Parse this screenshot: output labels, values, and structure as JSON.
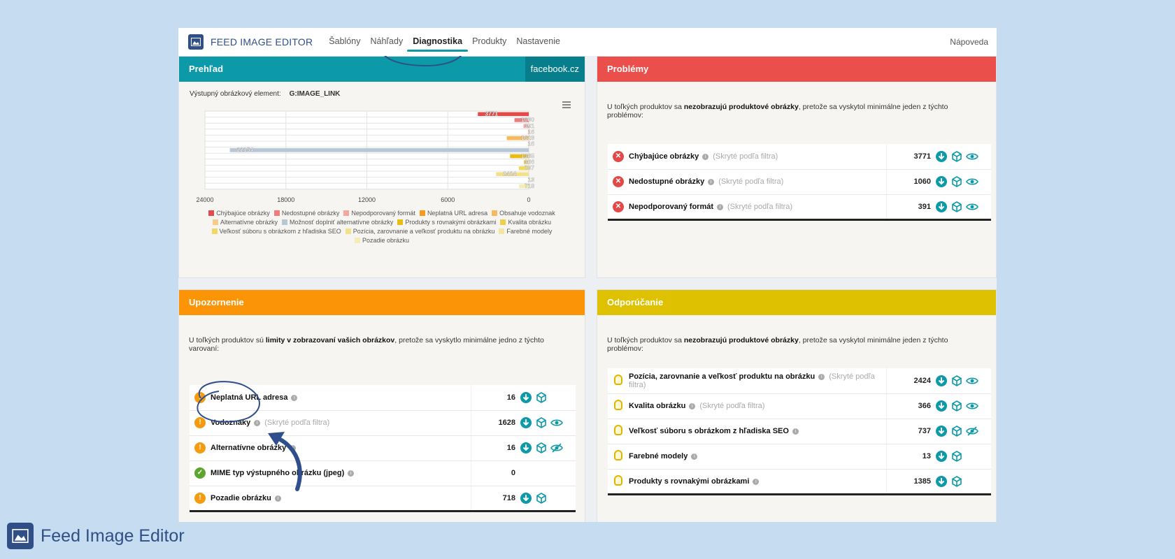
{
  "nav": {
    "brand": "FEED IMAGE EDITOR",
    "items": [
      "Šablóny",
      "Náhľady",
      "Diagnostika",
      "Produkty",
      "Nastavenie"
    ],
    "active": "Diagnostika",
    "help": "Nápoveda"
  },
  "overview": {
    "title": "Prehľad",
    "domain": "facebook.cz",
    "output_label": "Výstupný obrázkový element:",
    "output_value": "G:IMAGE_LINK"
  },
  "chart_data": {
    "type": "bar",
    "orientation": "horizontal",
    "xlim": [
      24000,
      0
    ],
    "xticks": [
      "24000",
      "18000",
      "12000",
      "6000",
      "0"
    ],
    "categories": [
      "Chýbajúce obrázky",
      "Nedostupné obrázky",
      "Nepodporovaný formát",
      "Neplatná URL adresa",
      "Obsahuje vodoznak",
      "Alternatívne obrázky",
      "Možnosť doplniť alternatívne obrázky",
      "Produkty s rovnakými obrázkami",
      "Kvalita obrázku",
      "Veľkosť súboru s obrázkom z hľadiska SEO",
      "Pozícia, zarovnanie a veľkosť produktu na obrázku",
      "Farebné modely",
      "Pozadie obrázku"
    ],
    "values": [
      3771,
      1060,
      391,
      16,
      1628,
      16,
      22154,
      1385,
      366,
      737,
      2424,
      13,
      718
    ],
    "colors": [
      "#e34b4b",
      "#ef7b7b",
      "#f5a6a0",
      "#f79a1c",
      "#f9b95a",
      "#f7cb8c",
      "#b8c7d6",
      "#e9bd14",
      "#efce4a",
      "#f0d864",
      "#f2e08a",
      "#f3e6a0",
      "#f5ecb6"
    ],
    "legend": [
      "Chýbajúce obrázky",
      "Nedostupné obrázky",
      "Nepodporovaný formát",
      "Neplatná URL adresa",
      "Obsahuje vodoznak",
      "Alternatívne obrázky",
      "Možnosť doplniť alternatívne obrázky",
      "Produkty s rovnakými obrázkami",
      "Kvalita obrázku",
      "Veľkosť súboru s obrázkom z hľadiska SEO",
      "Pozícia, zarovnanie a veľkosť produktu na obrázku",
      "Farebné modely",
      "Pozadie obrázku"
    ]
  },
  "problems": {
    "title": "Problémy",
    "desc_pre": "U toľkých produktov sa ",
    "desc_bold": "nezobrazujú produktové obrázky",
    "desc_post": ", pretože sa vyskytol minimálne jeden z týchto problémov:",
    "rows": [
      {
        "name": "Chýbajúce obrázky",
        "hidden": "(Skryté podľa filtra)",
        "count": "3771"
      },
      {
        "name": "Nedostupné obrázky",
        "hidden": "(Skryté podľa filtra)",
        "count": "1060"
      },
      {
        "name": "Nepodporovaný formát",
        "hidden": "(Skryté podľa filtra)",
        "count": "391"
      }
    ]
  },
  "warnings": {
    "title": "Upozornenie",
    "desc_pre": "U toľkých produktov sú ",
    "desc_bold": "limity v zobrazovaní vašich obrázkov",
    "desc_post": ", pretože sa vyskytlo minimálne jedno z týchto varovaní:",
    "rows": [
      {
        "name": "Neplatná URL adresa",
        "hidden": "",
        "count": "16"
      },
      {
        "name": "Vodoznaky",
        "hidden": "(Skryté podľa filtra)",
        "count": "1628"
      },
      {
        "name": "Alternatívne obrázky",
        "hidden": "",
        "count": "16"
      },
      {
        "name": "MIME typ výstupného obrázku (jpeg)",
        "hidden": "",
        "count": "0"
      },
      {
        "name": "Pozadie obrázku",
        "hidden": "",
        "count": "718"
      }
    ]
  },
  "recommend": {
    "title": "Odporúčanie",
    "desc_pre": "U toľkých produktov sa ",
    "desc_bold": "nezobrazujú produktové obrázky",
    "desc_post": ", pretože sa vyskytol minimálne jeden z týchto problémov:",
    "rows": [
      {
        "name": "Pozícia, zarovnanie a veľkosť produktu na obrázku",
        "hidden": "(Skryté podľa filtra)",
        "count": "2424"
      },
      {
        "name": "Kvalita obrázku",
        "hidden": "(Skryté podľa filtra)",
        "count": "366"
      },
      {
        "name": "Veľkosť súboru s obrázkom z hľadiska SEO",
        "hidden": "",
        "count": "737"
      },
      {
        "name": "Farebné modely",
        "hidden": "",
        "count": "13"
      },
      {
        "name": "Produkty s rovnakými obrázkami",
        "hidden": "",
        "count": "1385"
      }
    ]
  },
  "footer": {
    "text": "Feed Image Editor"
  },
  "colors": {
    "teal": "#0d9aa8",
    "red": "#ea4f4b",
    "orange": "#fb9407",
    "yellow": "#dec201",
    "brand": "#2f4f86"
  }
}
